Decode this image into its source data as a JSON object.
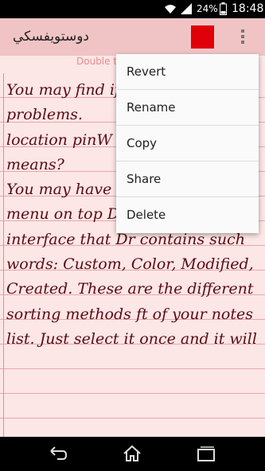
{
  "status_bar": {
    "battery_percent": "24%",
    "time": "18:48"
  },
  "action_bar": {
    "title": "دوستويفسكي",
    "swatch_color": "#e0000a"
  },
  "hint": "Double t",
  "note": {
    "text": "You may find if you have a problems.\nlocation pinW Color, Modifie means?\nYou may have seen a drop down menu on top Dr of Raloco Notes interface that Dr contains such words: Custom, Color, Modified, Created. These are the different sorting methods ft of your notes list. Just select it once and it will"
  },
  "menu": {
    "items": [
      "Revert",
      "Rename",
      "Copy",
      "Share",
      "Delete"
    ]
  }
}
